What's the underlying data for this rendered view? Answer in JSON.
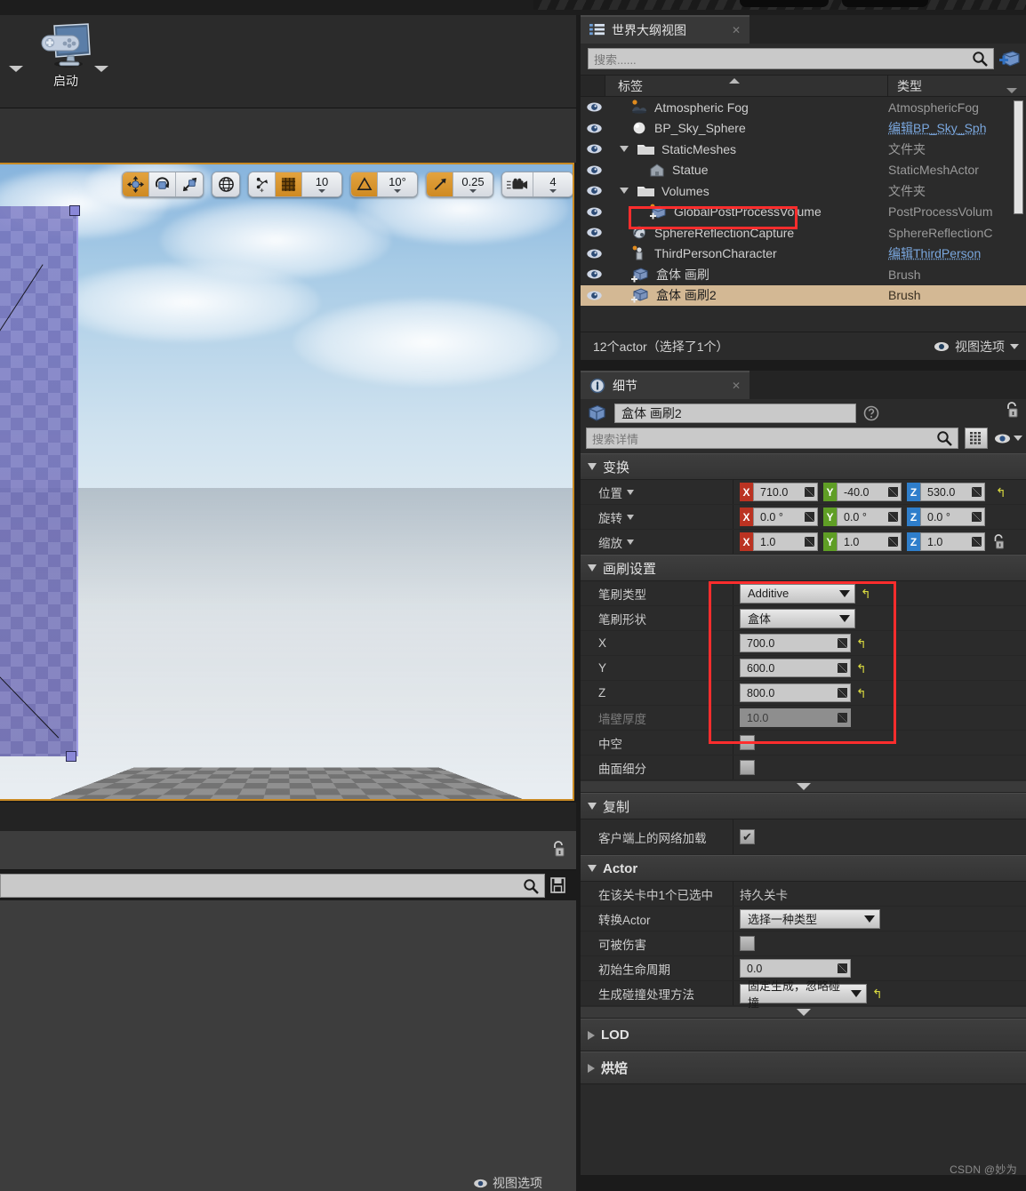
{
  "toolbar": {
    "launch_label": "启动"
  },
  "viewport": {
    "tools": [
      {
        "name": "select-translate",
        "glyph": "move",
        "active": true
      },
      {
        "name": "rotate",
        "glyph": "rotate",
        "active": false
      },
      {
        "name": "scale",
        "glyph": "scale",
        "active": false
      }
    ],
    "coord_space": {
      "name": "world-space-toggle",
      "glyph": "globe"
    },
    "surface_snap": {
      "name": "surface-snap-toggle",
      "glyph": "snap"
    },
    "grid_snap_toggle": {
      "active": true
    },
    "grid_snap_value": "10",
    "angle_snap_toggle": {
      "active": true
    },
    "angle_snap_value": "10°",
    "scale_snap_toggle": {
      "active": true
    },
    "scale_snap_value": "0.25",
    "camera_speed_value": "4",
    "maximize_label": ""
  },
  "outliner": {
    "tab_title": "世界大纲视图",
    "search_placeholder": "搜索......",
    "columns": {
      "label": "标签",
      "type": "类型"
    },
    "rows": [
      {
        "label": "Atmospheric Fog",
        "type": "AtmosphericFog",
        "indent": 0,
        "icon": "fog-icon",
        "link": false,
        "folder": false,
        "selected": false
      },
      {
        "label": "BP_Sky_Sphere",
        "type": "编辑BP_Sky_Sph",
        "indent": 0,
        "icon": "sphere-icon",
        "link": true,
        "folder": false,
        "selected": false
      },
      {
        "label": "StaticMeshes",
        "type": "文件夹",
        "indent": 0,
        "icon": "folder-icon",
        "link": false,
        "folder": true,
        "selected": false
      },
      {
        "label": "Statue",
        "type": "StaticMeshActor",
        "indent": 1,
        "icon": "mesh-icon",
        "link": false,
        "folder": false,
        "selected": false
      },
      {
        "label": "Volumes",
        "type": "文件夹",
        "indent": 0,
        "icon": "folder-icon",
        "link": false,
        "folder": true,
        "selected": false
      },
      {
        "label": "GlobalPostProcessVolume",
        "type": "PostProcessVolum",
        "indent": 1,
        "icon": "volume-icon",
        "link": false,
        "folder": false,
        "selected": false
      },
      {
        "label": "SphereReflectionCapture",
        "type": "SphereReflectionC",
        "indent": 0,
        "icon": "reflection-icon",
        "link": false,
        "folder": false,
        "selected": false
      },
      {
        "label": "ThirdPersonCharacter",
        "type": "编辑ThirdPerson",
        "indent": 0,
        "icon": "character-icon",
        "link": true,
        "folder": false,
        "selected": false
      },
      {
        "label": "盒体 画刷",
        "type": "Brush",
        "indent": 0,
        "icon": "brush-icon",
        "link": false,
        "folder": false,
        "selected": false
      },
      {
        "label": "盒体 画刷2",
        "type": "Brush",
        "indent": 0,
        "icon": "brush-icon",
        "link": false,
        "folder": false,
        "selected": true
      }
    ],
    "status": "12个actor（选择了1个）",
    "view_options_label": "视图选项"
  },
  "details": {
    "tab_title": "细节",
    "actor_name": "盒体 画刷2",
    "search_placeholder": "搜索详情",
    "transform": {
      "header": "变换",
      "location": {
        "label": "位置",
        "x": "710.0",
        "y": "-40.0",
        "z": "530.0"
      },
      "rotation": {
        "label": "旋转",
        "x": "0.0 °",
        "y": "0.0 °",
        "z": "0.0 °"
      },
      "scale": {
        "label": "缩放",
        "x": "1.0",
        "y": "1.0",
        "z": "1.0"
      },
      "axis_labels": {
        "x": "X",
        "y": "Y",
        "z": "Z"
      }
    },
    "brush_settings": {
      "header": "画刷设置",
      "brush_type_label": "笔刷类型",
      "brush_type_value": "Additive",
      "brush_shape_label": "笔刷形状",
      "brush_shape_value": "盒体",
      "x_label": "X",
      "x_value": "700.0",
      "y_label": "Y",
      "y_value": "600.0",
      "z_label": "Z",
      "z_value": "800.0",
      "wall_thickness_label": "墙壁厚度",
      "wall_thickness_value": "10.0",
      "hollow_label": "中空",
      "hollow_checked": false,
      "tessellated_label": "曲面细分",
      "tessellated_checked": false
    },
    "replication": {
      "header": "复制",
      "net_load_label": "客户端上的网络加载",
      "net_load_checked": true,
      "check_glyph": "✔"
    },
    "actor": {
      "header": "Actor",
      "selected_in_level_label": "在该关卡中1个已选中",
      "selected_in_level_value": "持久关卡",
      "convert_actor_label": "转换Actor",
      "convert_actor_value": "选择一种类型",
      "can_be_damaged_label": "可被伤害",
      "can_be_damaged_checked": false,
      "initial_lifespan_label": "初始生命周期",
      "initial_lifespan_value": "0.0",
      "spawn_collision_label": "生成碰撞处理方法",
      "spawn_collision_value": "固定生成，忽略碰撞"
    },
    "lod": {
      "header": "LOD"
    },
    "bake": {
      "header": "烘焙"
    }
  },
  "bottom": {
    "partial_label": "视图选项",
    "watermark": "CSDN @妙为"
  },
  "colors": {
    "accent_orange": "#cf8a22",
    "highlight_red": "#ff2d2d",
    "selection_tan": "#d3b894",
    "axis_x": "#bb3322",
    "axis_y": "#5f9e25",
    "axis_z": "#2f7ecb",
    "link_blue": "#7aa7de",
    "revert_yellow": "#d9d93f"
  }
}
